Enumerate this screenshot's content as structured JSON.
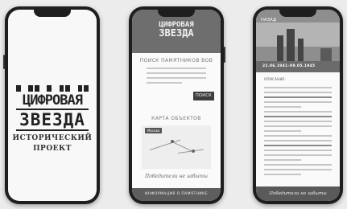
{
  "splash": {
    "brand_line1": "ЦИФРОВАЯ",
    "brand_line2": "ЗВЕЗДА",
    "subtitle_line1": "ИСТОРИЧЕСКИЙ",
    "subtitle_line2": "ПРОЕКТ"
  },
  "search_screen": {
    "logo_line1": "ЦИФРОВАЯ",
    "logo_line2": "ЗВЕЗДА",
    "search_title": "ПОИСК ПАМЯТНИКОВ ВОВ",
    "search_button": "ПОИСК",
    "map_title": "КАРТА ОБЪЕКТОВ",
    "map_tag": "Москва",
    "script_text": "Победители не забыты",
    "footer_text": "ИНФОРМАЦИЯ О ПАМЯТНИКЕ"
  },
  "detail_screen": {
    "back_label": "НАЗАД",
    "date_label": "22.06.1941–09.05.1945",
    "description_label": "ОПИСАНИЕ:",
    "footer_text": "Победители не забыты"
  },
  "colors": {
    "phone_frame": "#1e1e1e",
    "header_gray": "#6e6e6e",
    "button_dark": "#3d3d3d"
  }
}
